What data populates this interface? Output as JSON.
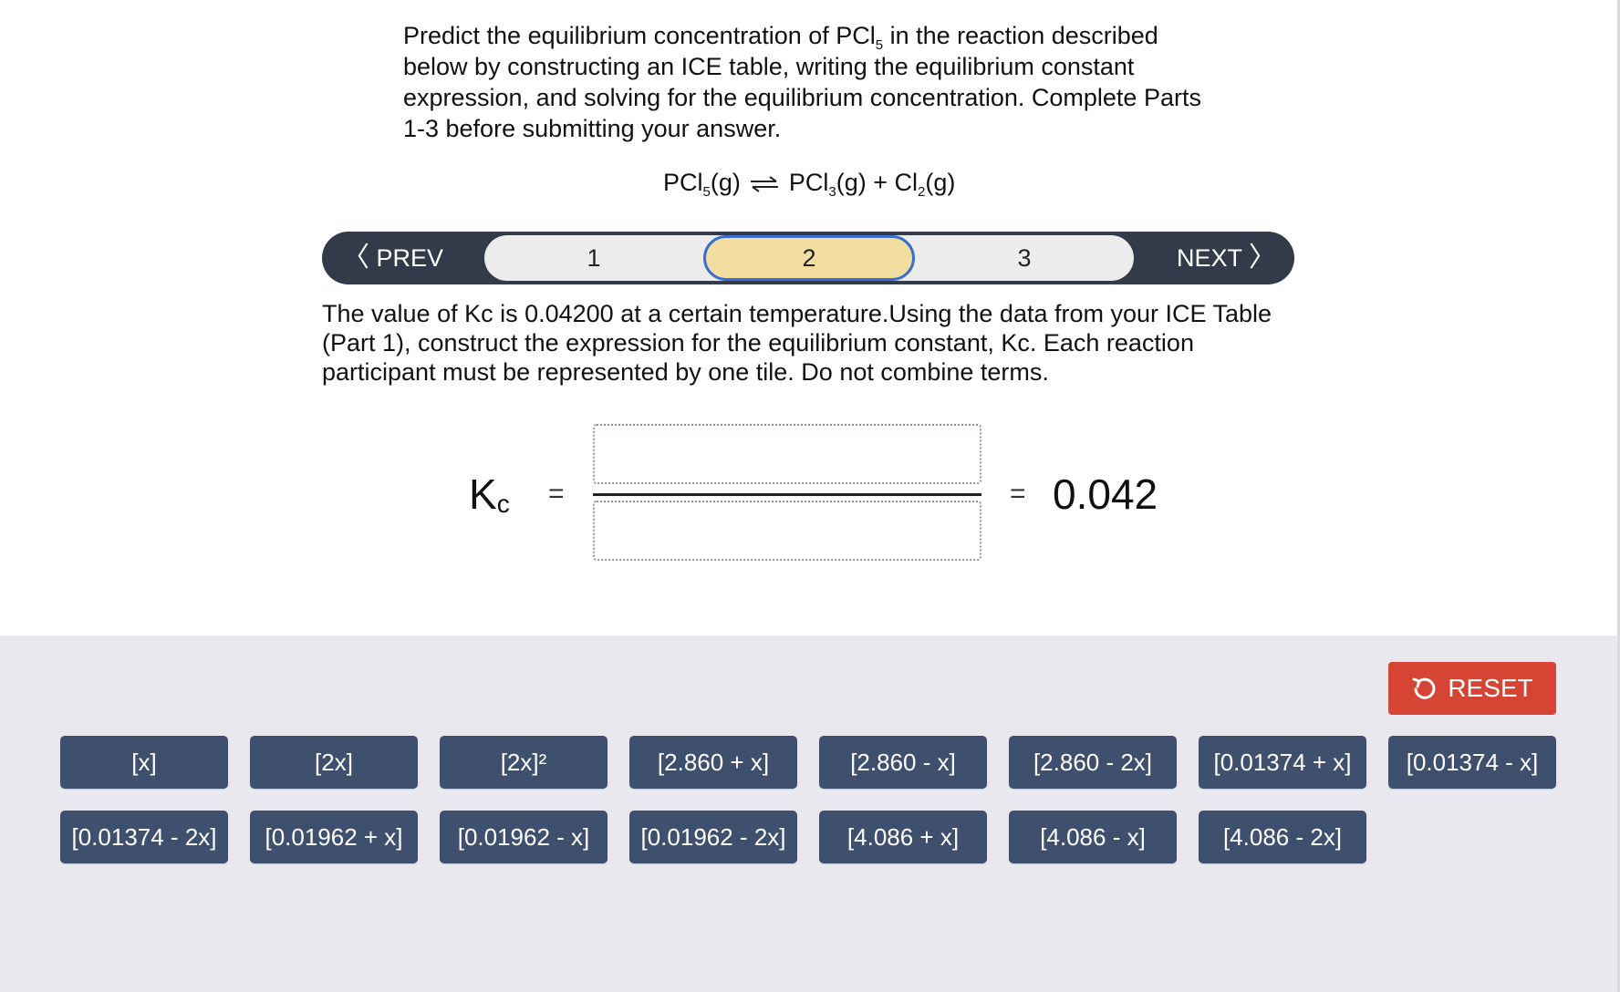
{
  "question": {
    "line_a": "Predict the equilibrium concentration of PCl",
    "sub_a": "5",
    "line_b": " in the reaction described below by constructing an ICE table, writing the equilibrium constant expression, and solving for the equilibrium concentration. Complete Parts 1-3 before submitting your answer."
  },
  "reaction": {
    "r1": "PCl",
    "r1_sub": "5",
    "r1_state": "(g)",
    "p1": "PCl",
    "p1_sub": "3",
    "p1_state": "(g) + Cl",
    "p2_sub": "2",
    "p2_state": "(g)"
  },
  "navigator": {
    "prev_label": "PREV",
    "next_label": "NEXT",
    "steps": [
      "1",
      "2",
      "3"
    ],
    "active_step": "2"
  },
  "instructions": "The value of Kc is  0.04200 at a certain temperature.Using the data from your ICE Table (Part 1), construct the expression for the equilibrium constant, Kc. Each reaction participant must be represented by one tile. Do not combine terms.",
  "expression": {
    "k_letter": "K",
    "k_sub": "c",
    "equals": "=",
    "value": "0.042"
  },
  "reset_label": "RESET",
  "tiles": [
    "[x]",
    "[2x]",
    "[2x]²",
    "[2.860 + x]",
    "[2.860 - x]",
    "[2.860 - 2x]",
    "[0.01374 + x]",
    "[0.01374 - x]",
    "[0.01374 - 2x]",
    "[0.01962 + x]",
    "[0.01962 - x]",
    "[0.01962 - 2x]",
    "[4.086 + x]",
    "[4.086 - x]",
    "[4.086 - 2x]"
  ],
  "colors": {
    "tile": "#3f4f6e",
    "reset": "#d64533",
    "active_step": "#f2dea0",
    "active_border": "#3b6fcf",
    "nav_bar": "#333b4a",
    "tray": "#e9e8ee"
  },
  "icons": {
    "prev": "chevron-left-icon",
    "next": "chevron-right-icon",
    "reset": "undo-icon",
    "equilibrium": "equilibrium-arrows-icon"
  }
}
